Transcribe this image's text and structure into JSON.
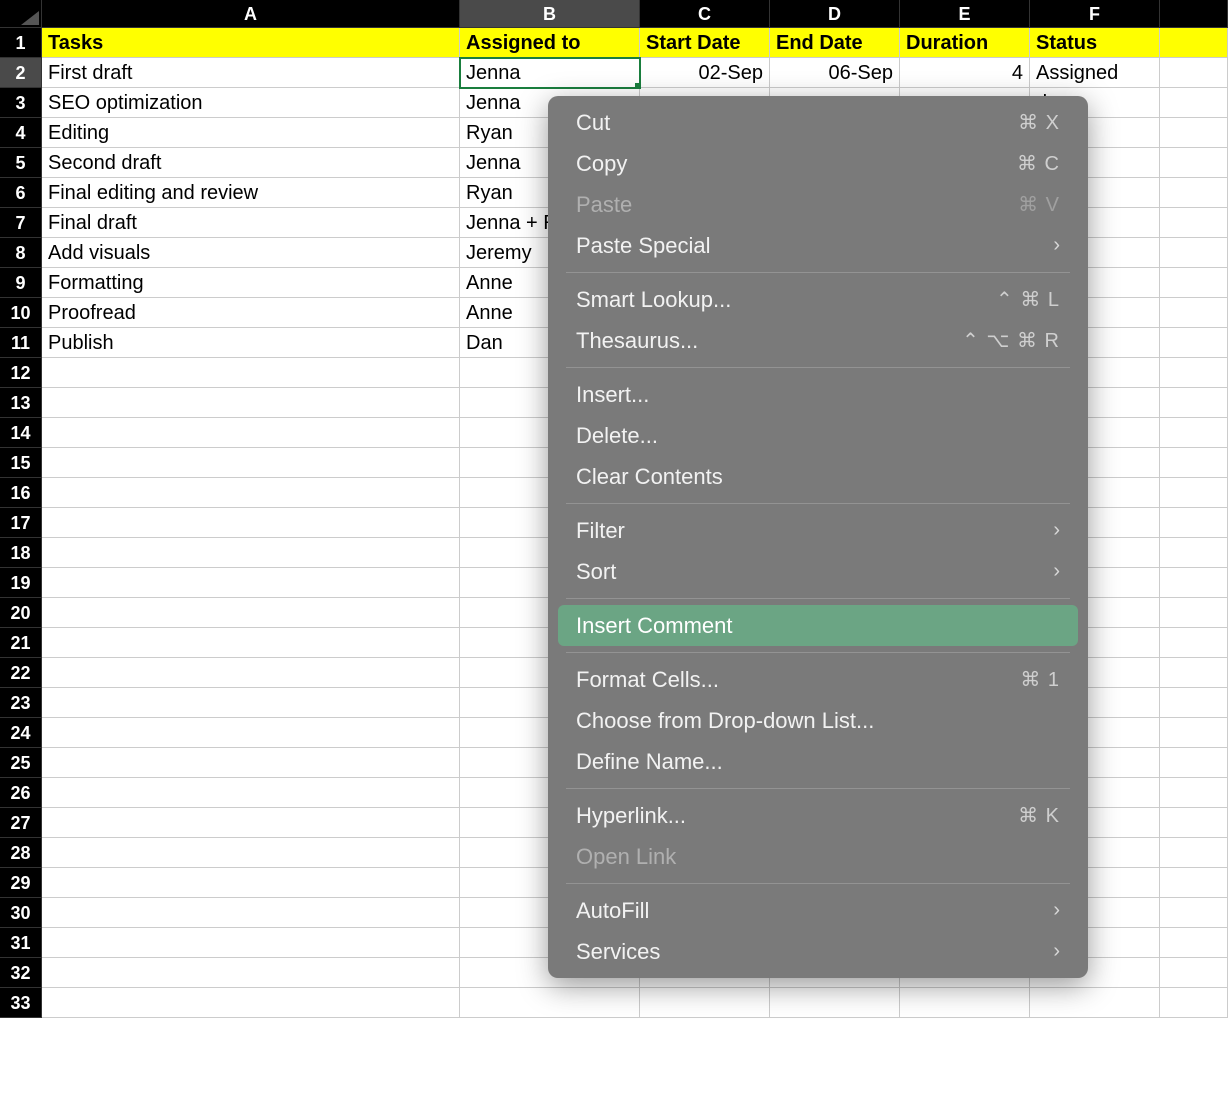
{
  "columns": [
    "A",
    "B",
    "C",
    "D",
    "E",
    "F"
  ],
  "row_numbers": [
    1,
    2,
    3,
    4,
    5,
    6,
    7,
    8,
    9,
    10,
    11,
    12,
    13,
    14,
    15,
    16,
    17,
    18,
    19,
    20,
    21,
    22,
    23,
    24,
    25,
    26,
    27,
    28,
    29,
    30,
    31,
    32,
    33
  ],
  "header_row": {
    "tasks": "Tasks",
    "assigned_to": "Assigned to",
    "start_date": "Start Date",
    "end_date": "End Date",
    "duration": "Duration",
    "status": "Status"
  },
  "data_rows": [
    {
      "a": "First draft",
      "b": "Jenna",
      "c": "02-Sep",
      "d": "06-Sep",
      "e": "4",
      "f": "Assigned"
    },
    {
      "a": "SEO optimization",
      "b": "Jenna",
      "c": "",
      "d": "",
      "e": "",
      "f": "d"
    },
    {
      "a": "Editing",
      "b": "Ryan",
      "c": "",
      "d": "",
      "e": "",
      "f": ""
    },
    {
      "a": "Second draft",
      "b": "Jenna",
      "c": "",
      "d": "",
      "e": "",
      "f": ""
    },
    {
      "a": "Final editing and review",
      "b": "Ryan",
      "c": "",
      "d": "",
      "e": "",
      "f": ""
    },
    {
      "a": "Final draft",
      "b": "Jenna + R",
      "c": "",
      "d": "",
      "e": "",
      "f": ""
    },
    {
      "a": "Add visuals",
      "b": "Jeremy",
      "c": "",
      "d": "",
      "e": "",
      "f": ""
    },
    {
      "a": "Formatting",
      "b": "Anne",
      "c": "",
      "d": "",
      "e": "",
      "f": ""
    },
    {
      "a": "Proofread",
      "b": "Anne",
      "c": "",
      "d": "",
      "e": "",
      "f": ""
    },
    {
      "a": "Publish",
      "b": "Dan",
      "c": "",
      "d": "",
      "e": "",
      "f": ""
    }
  ],
  "selected_cell": "B2",
  "context_menu": {
    "cut": "Cut",
    "cut_sc": "⌘ X",
    "copy": "Copy",
    "copy_sc": "⌘ C",
    "paste": "Paste",
    "paste_sc": "⌘ V",
    "paste_special": "Paste Special",
    "smart_lookup": "Smart Lookup...",
    "smart_lookup_sc": "⌃ ⌘ L",
    "thesaurus": "Thesaurus...",
    "thesaurus_sc": "⌃ ⌥ ⌘ R",
    "insert": "Insert...",
    "delete": "Delete...",
    "clear_contents": "Clear Contents",
    "filter": "Filter",
    "sort": "Sort",
    "insert_comment": "Insert Comment",
    "format_cells": "Format Cells...",
    "format_cells_sc": "⌘ 1",
    "choose_dropdown": "Choose from Drop-down List...",
    "define_name": "Define Name...",
    "hyperlink": "Hyperlink...",
    "hyperlink_sc": "⌘ K",
    "open_link": "Open Link",
    "autofill": "AutoFill",
    "services": "Services"
  }
}
